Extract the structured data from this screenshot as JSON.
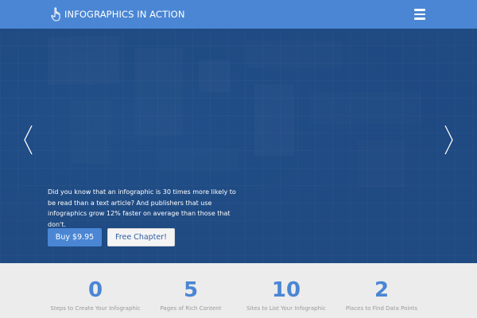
{
  "navbar": {
    "brand": "Infographics in Action",
    "brand_icon": "pointing-hand-icon",
    "menu_icon": "hamburger-menu-icon"
  },
  "hero": {
    "prev_icon": "chevron-left-icon",
    "next_icon": "chevron-right-icon",
    "text": "Did you know that an infographic is 30 times more likely to be read than a text article? And publishers that use infographics grow 12% faster on average than those that don't.",
    "buy_label": "Buy $9.95",
    "free_label": "Free Chapter!"
  },
  "stats": [
    {
      "number": "0",
      "label": "Steps to Create Your Infographic"
    },
    {
      "number": "5",
      "label": "Pages of Rich Content"
    },
    {
      "number": "10",
      "label": "Sites to List Your Infographic"
    },
    {
      "number": "2",
      "label": "Places to Find Data Points"
    }
  ],
  "colors": {
    "accent": "#4a86d4",
    "hero_bg": "#1f4a82",
    "stats_bg": "#ececec"
  }
}
